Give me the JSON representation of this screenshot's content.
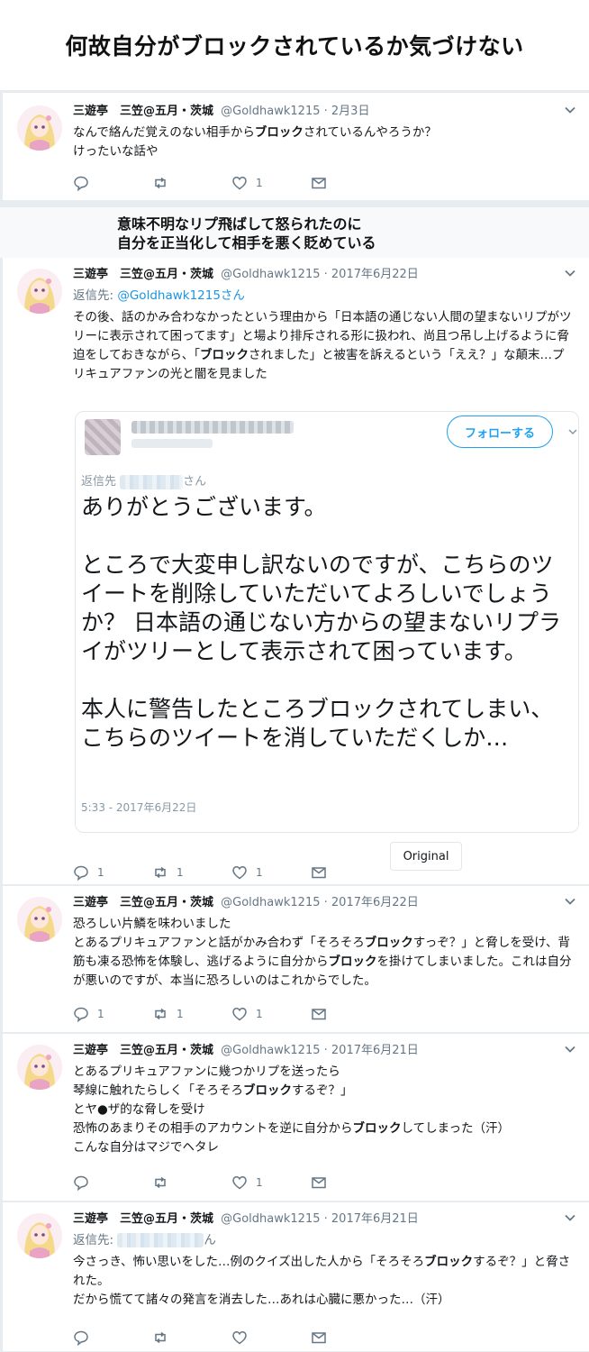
{
  "page_title": "何故自分がブロックされているか気づけない",
  "annotation": {
    "line1": "意味不明なリプ飛ばして怒られたのに",
    "line2": "自分を正当化して相手を悪く貶めている"
  },
  "author": {
    "name": "三遊亭　三笠@五月・茨城",
    "handle": "@Goldhawk1215"
  },
  "tweets": [
    {
      "date": "2月3日",
      "lines": [
        "なんで絡んだ覚えのない相手から",
        "ブロック",
        "されているんやろうか？",
        "けったいな話や"
      ],
      "reply": "",
      "retweet": "",
      "like": "1"
    },
    {
      "date": "2017年6月22日",
      "reply_to_label": "返信先: ",
      "reply_to_link": "@Goldhawk1215さん",
      "segments": [
        "その後、話のかみ合わなかったという理由から「日本語の通じない人間の望まないリプがツリーに表示されて困ってます」と場より排斥される形に扱われ、尚且つ吊し上げるように脅迫をしておきながら、「",
        "ブロック",
        "されました」と被害を訴えるという「ええ？」な顛末…プリキュアファンの光と闇を見ました"
      ],
      "embed": {
        "follow_label": "フォローする",
        "reply_prefix": "返信先",
        "reply_suffix": "さん",
        "paragraphs": [
          "ありがとうございます。",
          "ところで大変申し訳ないのですが、こちらのツイートを削除していただいてよろしいでしょうか？ 日本語の通じない方からの望まないリプライがツリーとして表示されて困っています。",
          "本人に警告したところブロックされてしまい、こちらのツイートを消していただくしか…"
        ],
        "timestamp": "5:33 - 2017年6月22日"
      },
      "reply": "1",
      "retweet": "1",
      "like": "1",
      "original_label": "Original"
    },
    {
      "date": "2017年6月22日",
      "line1": "恐ろしい片鱗を味わいました",
      "segments": [
        "とあるプリキュアファンと話がかみ合わず「そろそろ",
        "ブロック",
        "すっぞ？」と脅しを受け、背筋も凍る恐怖を体験し、逃げるように自分から",
        "ブロック",
        "を掛けてしまいました。これは自分が悪いのですが、本当に恐ろしいのはこれからでした。"
      ],
      "reply": "1",
      "retweet": "1",
      "like": "1"
    },
    {
      "date": "2017年6月21日",
      "line1": "とあるプリキュアファンに幾つかリプを送ったら",
      "line2a": "琴線に触れたらしく「そろそろ",
      "line2b": "ブロック",
      "line2c": "するぞ？」",
      "line3": "とヤ●ザ的な脅しを受け",
      "line4a": "恐怖のあまりその相手のアカウントを逆に自分から",
      "line4b": "ブロック",
      "line4c": "してしまった（汗）",
      "line5": "こんな自分はマジでヘタレ",
      "reply": "",
      "retweet": "",
      "like": "1"
    },
    {
      "date": "2017年6月21日",
      "reply_to_label": "返信先: ",
      "reply_to_suffix": "ん",
      "segments": [
        "今さっき、怖い思いをした…例のクイズ出した人から「そろそろ",
        "ブロック",
        "するぞ？」と脅された。"
      ],
      "line3": "だから慌てて諸々の発言を消去した…あれは心臓に悪かった…（汗）",
      "reply": "",
      "retweet": "",
      "like": ""
    }
  ],
  "colors": {
    "accent": "#1da1f2",
    "muted": "#657786",
    "background": "#e6ecf0"
  }
}
